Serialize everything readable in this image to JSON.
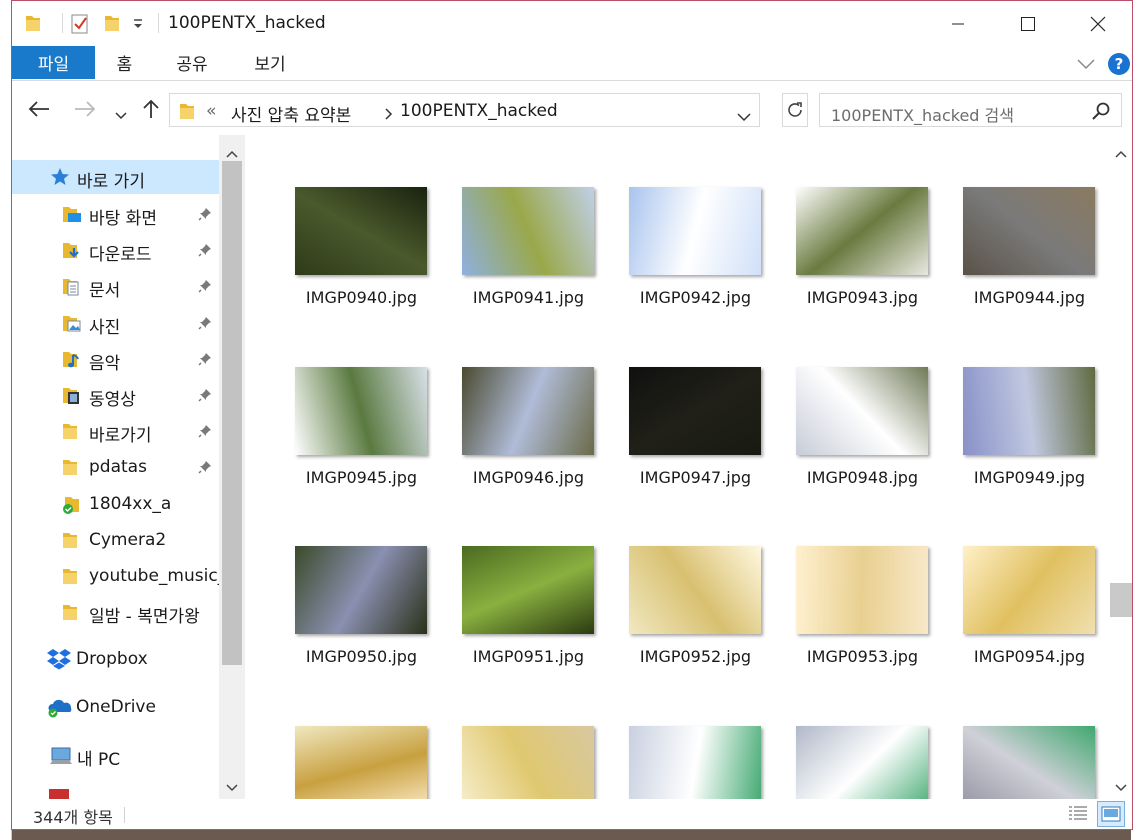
{
  "window": {
    "title": "100PENTX_hacked"
  },
  "ribbon": {
    "tabs": [
      {
        "label": "파일",
        "active": true
      },
      {
        "label": "홈",
        "active": false
      },
      {
        "label": "공유",
        "active": false
      },
      {
        "label": "보기",
        "active": false
      }
    ]
  },
  "address": {
    "overflow": "«",
    "crumbs": [
      "사진 압축 요약본",
      "100PENTX_hacked"
    ],
    "search_placeholder": "100PENTX_hacked 검색"
  },
  "nav": {
    "quick_access": "바로 가기",
    "items": [
      {
        "label": "바탕 화면",
        "icon": "desktop-folder-icon",
        "pinned": true
      },
      {
        "label": "다운로드",
        "icon": "download-folder-icon",
        "pinned": true
      },
      {
        "label": "문서",
        "icon": "documents-folder-icon",
        "pinned": true
      },
      {
        "label": "사진",
        "icon": "pictures-folder-icon",
        "pinned": true
      },
      {
        "label": "음악",
        "icon": "music-folder-icon",
        "pinned": true
      },
      {
        "label": "동영상",
        "icon": "videos-folder-icon",
        "pinned": true
      },
      {
        "label": "바로가기",
        "icon": "folder-icon",
        "pinned": true
      },
      {
        "label": "pdatas",
        "icon": "folder-icon",
        "pinned": true
      },
      {
        "label": "1804xx_a",
        "icon": "synced-folder-icon",
        "pinned": false
      },
      {
        "label": "Cymera2",
        "icon": "folder-icon",
        "pinned": false
      },
      {
        "label": "youtube_music_",
        "icon": "folder-icon",
        "pinned": false
      },
      {
        "label": "일밤 - 복면가왕",
        "icon": "folder-icon",
        "pinned": false
      }
    ],
    "dropbox": "Dropbox",
    "onedrive": "OneDrive",
    "pc": "내 PC"
  },
  "files": [
    {
      "name": "IMGP0940.jpg",
      "colors": [
        "#2e3a1a",
        "#4a5a2c",
        "#1a220f"
      ]
    },
    {
      "name": "IMGP0941.jpg",
      "colors": [
        "#8fb0e0",
        "#9aa84a",
        "#c0d0e8"
      ]
    },
    {
      "name": "IMGP0942.jpg",
      "colors": [
        "#a8c4ee",
        "#ffffff",
        "#d0e0f8"
      ]
    },
    {
      "name": "IMGP0943.jpg",
      "colors": [
        "#ffffff",
        "#6a7a40",
        "#e8e8e0"
      ]
    },
    {
      "name": "IMGP0944.jpg",
      "colors": [
        "#5a5248",
        "#7a7a7a",
        "#8a7a60"
      ]
    },
    {
      "name": "IMGP0945.jpg",
      "colors": [
        "#ffffff",
        "#5a7a40",
        "#d8e0e8"
      ]
    },
    {
      "name": "IMGP0946.jpg",
      "colors": [
        "#4a4a30",
        "#b0bcd8",
        "#6a6a48"
      ]
    },
    {
      "name": "IMGP0947.jpg",
      "colors": [
        "#101010",
        "#202018",
        "#181a12"
      ]
    },
    {
      "name": "IMGP0948.jpg",
      "colors": [
        "#c8ccd8",
        "#ffffff",
        "#707a58"
      ]
    },
    {
      "name": "IMGP0949.jpg",
      "colors": [
        "#8890c8",
        "#c0c8e0",
        "#606a40"
      ]
    },
    {
      "name": "IMGP0950.jpg",
      "colors": [
        "#3a4a2a",
        "#8a90b0",
        "#2a3018"
      ]
    },
    {
      "name": "IMGP0951.jpg",
      "colors": [
        "#4a6a20",
        "#8ab040",
        "#2a3a10"
      ]
    },
    {
      "name": "IMGP0952.jpg",
      "colors": [
        "#f0e8c0",
        "#d8c070",
        "#fff8e0"
      ]
    },
    {
      "name": "IMGP0953.jpg",
      "colors": [
        "#fff0d0",
        "#e8d090",
        "#f8e8c8"
      ]
    },
    {
      "name": "IMGP0954.jpg",
      "colors": [
        "#fff0c8",
        "#e0c060",
        "#f0e0b0"
      ]
    },
    {
      "name": "",
      "colors": [
        "#f0e8c0",
        "#c8a040",
        "#fff0d0"
      ]
    },
    {
      "name": "",
      "colors": [
        "#f8f0d0",
        "#e0c870",
        "#d8c8a0"
      ]
    },
    {
      "name": "",
      "colors": [
        "#c8d0e0",
        "#ffffff",
        "#40a870"
      ]
    },
    {
      "name": "",
      "colors": [
        "#b0b8c8",
        "#ffffff",
        "#40a870"
      ]
    },
    {
      "name": "",
      "colors": [
        "#9090a0",
        "#d0d0d8",
        "#40a870"
      ]
    }
  ],
  "status": {
    "count": "344개 항목"
  },
  "colors": {
    "accent": "#1979ca",
    "selection": "#cce8ff",
    "help": "#1a73d0"
  }
}
